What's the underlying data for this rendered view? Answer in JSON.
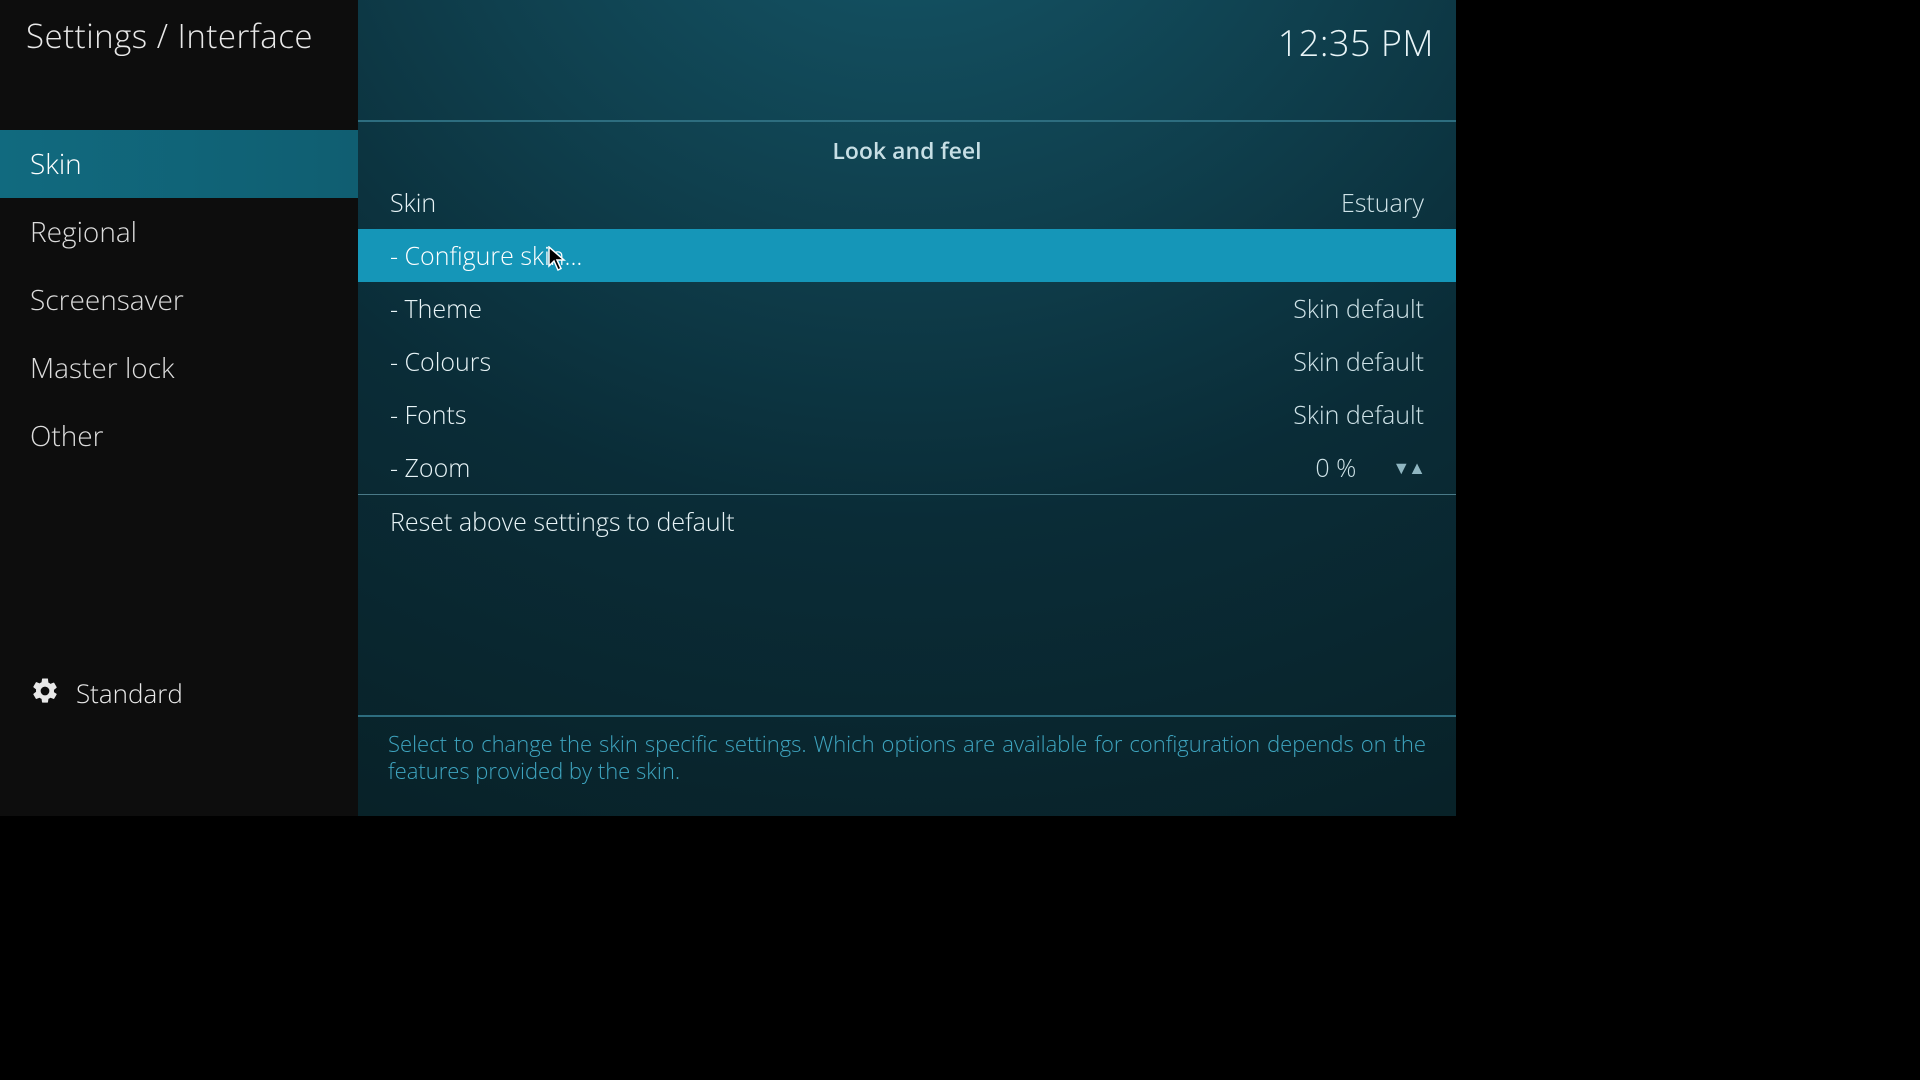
{
  "header": {
    "breadcrumb": "Settings / Interface"
  },
  "clock": "12:35 PM",
  "sidebar": {
    "items": [
      {
        "label": "Skin",
        "active": true
      },
      {
        "label": "Regional",
        "active": false
      },
      {
        "label": "Screensaver",
        "active": false
      },
      {
        "label": "Master lock",
        "active": false
      },
      {
        "label": "Other",
        "active": false
      }
    ],
    "level_label": "Standard"
  },
  "main": {
    "section_title": "Look and feel",
    "rows": [
      {
        "label": "Skin",
        "value": "Estuary",
        "highlight": false,
        "type": "select"
      },
      {
        "label": "- Configure skin...",
        "value": "",
        "highlight": true,
        "type": "action"
      },
      {
        "label": "- Theme",
        "value": "Skin default",
        "highlight": false,
        "type": "select"
      },
      {
        "label": "- Colours",
        "value": "Skin default",
        "highlight": false,
        "type": "select"
      },
      {
        "label": "- Fonts",
        "value": "Skin default",
        "highlight": false,
        "type": "select"
      },
      {
        "label": "- Zoom",
        "value": "0 %",
        "highlight": false,
        "type": "spinner"
      }
    ],
    "reset_label": "Reset above settings to default",
    "description": "Select to change the skin specific settings. Which options are available for configuration depends on the features provided by the skin."
  }
}
